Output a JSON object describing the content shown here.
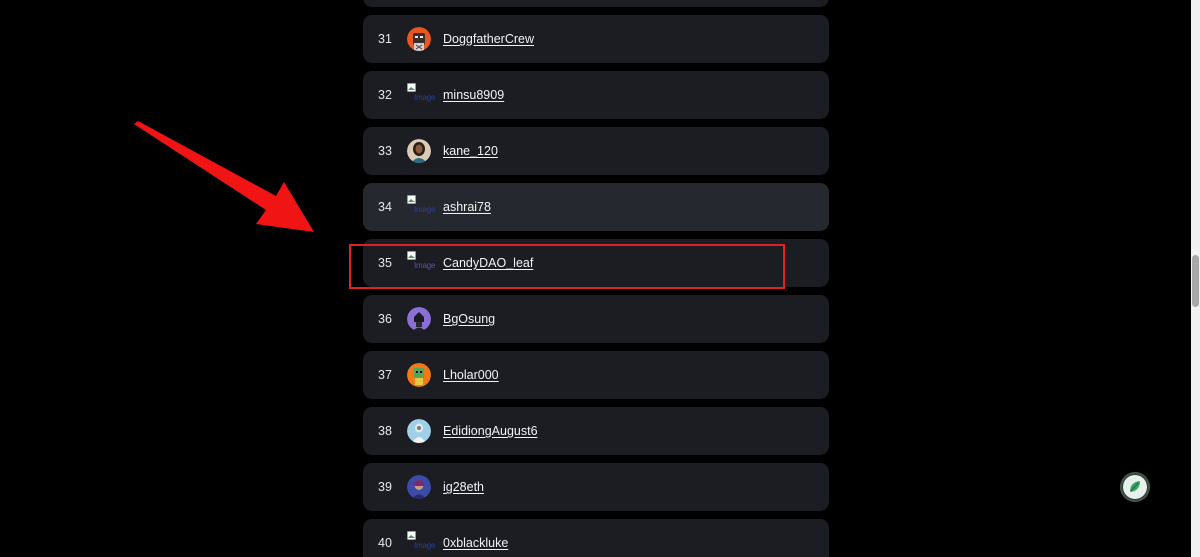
{
  "leaderboard": {
    "rows": [
      {
        "rank": "",
        "name": "",
        "avatar": "none"
      },
      {
        "rank": "31",
        "name": "DoggfatherCrew",
        "avatar": "dog-avatar"
      },
      {
        "rank": "32",
        "name": "minsu8909",
        "avatar": "broken-image",
        "alt": "Image"
      },
      {
        "rank": "33",
        "name": "kane_120",
        "avatar": "person-avatar"
      },
      {
        "rank": "34",
        "name": "ashrai78",
        "avatar": "broken-image",
        "alt": "Image"
      },
      {
        "rank": "35",
        "name": "CandyDAO_leaf",
        "avatar": "broken-image",
        "alt": "Image"
      },
      {
        "rank": "36",
        "name": "BgOsung",
        "avatar": "purple-avatar"
      },
      {
        "rank": "37",
        "name": "Lholar000",
        "avatar": "orange-avatar"
      },
      {
        "rank": "38",
        "name": "EdidiongAugust6",
        "avatar": "blue-sky-avatar"
      },
      {
        "rank": "39",
        "name": "ig28eth",
        "avatar": "blue-avatar"
      },
      {
        "rank": "40",
        "name": "0xblackluke",
        "avatar": "broken-image",
        "alt": "Image"
      }
    ]
  },
  "annotations": {
    "arrow_color": "#f01414",
    "highlight_color": "#e02222",
    "highlighted_rank": "35"
  },
  "colors": {
    "background": "#000000",
    "row_bg": "#1b1d23",
    "row_hover_bg": "#262830",
    "text": "#f2f2f2"
  },
  "floating_button": {
    "icon": "chat-leaf-icon"
  }
}
